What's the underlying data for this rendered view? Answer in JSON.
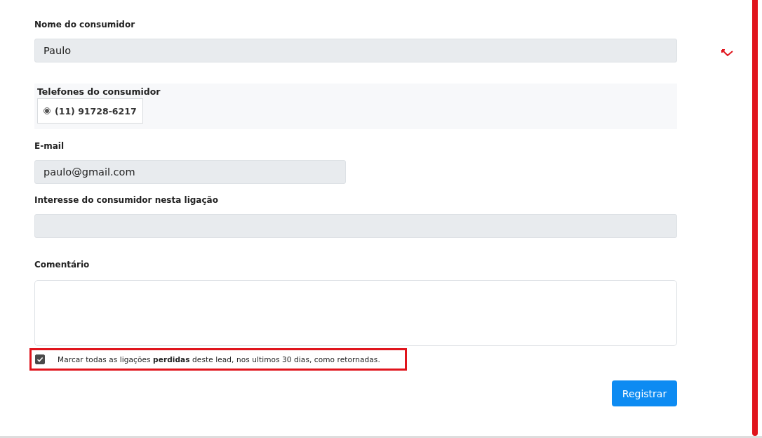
{
  "name_field": {
    "label": "Nome do consumidor",
    "value": "Paulo"
  },
  "phones": {
    "label": "Telefones do consumidor",
    "items": [
      {
        "number": "(11) 91728-6217",
        "selected": true
      }
    ]
  },
  "email_field": {
    "label": "E-mail",
    "value": "paulo@gmail.com"
  },
  "interest_field": {
    "label": "Interesse do consumidor nesta ligação"
  },
  "comment_field": {
    "label": "Comentário"
  },
  "mark_missed": {
    "text": "Marcar todas as ligações **perdidas** deste lead, nos ultimos 30 dias, como retornadas.",
    "checked": true
  },
  "submit_button": "Registrar"
}
